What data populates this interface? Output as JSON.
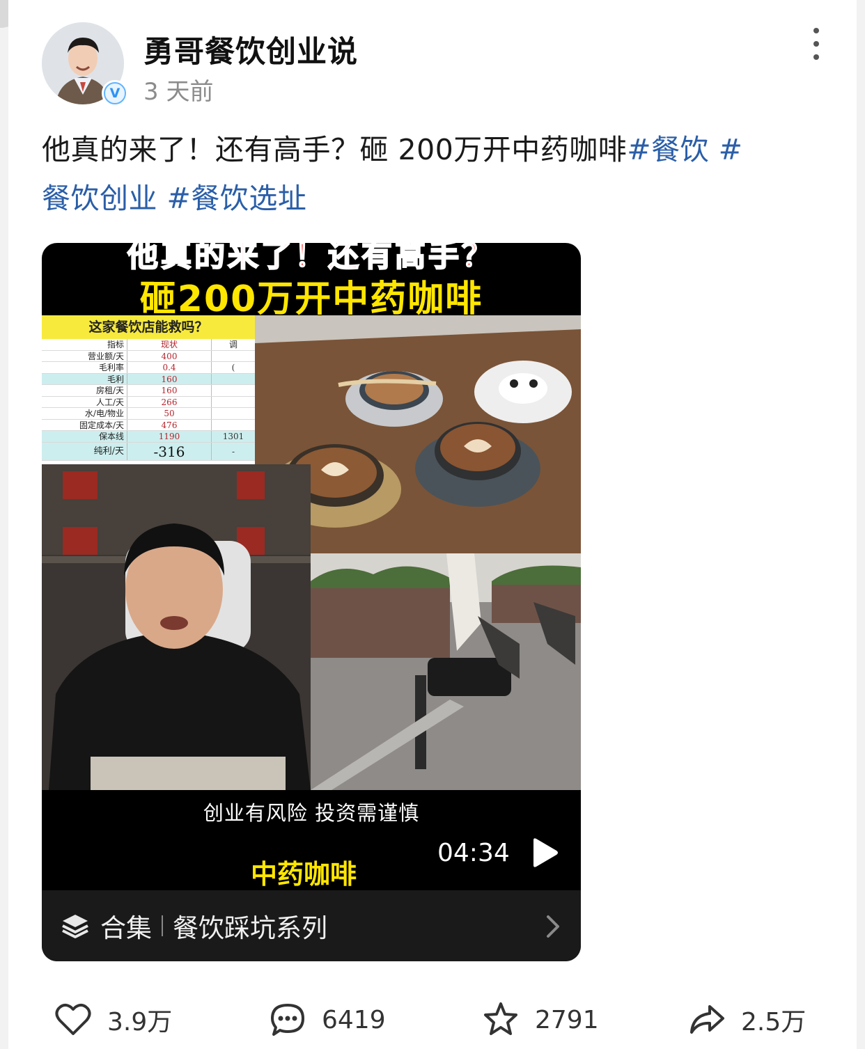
{
  "author": {
    "name": "勇哥餐饮创业说",
    "time": "3 天前",
    "verified_badge": "V"
  },
  "post": {
    "text": "他真的来了！还有高手？砸 200万开中药咖啡",
    "hashtags": [
      "#餐饮 #",
      "餐饮创业 ",
      "#餐饮选址"
    ]
  },
  "video": {
    "title_line1": "他真的来了！还有高手？",
    "title_line2": "砸200万开中药咖啡",
    "table": {
      "heading": "这家餐饮店能救吗？",
      "columns": [
        "指标",
        "现状",
        "调"
      ],
      "rows": [
        {
          "label": "营业额/天",
          "value": "400",
          "extra": ""
        },
        {
          "label": "毛利率",
          "value": "0.4",
          "extra": "("
        },
        {
          "label": "毛利",
          "value": "160",
          "extra": ""
        },
        {
          "label": "房租/天",
          "value": "160",
          "extra": ""
        },
        {
          "label": "人工/天",
          "value": "266",
          "extra": ""
        },
        {
          "label": "水/电/物业",
          "value": "50",
          "extra": ""
        },
        {
          "label": "固定成本/天",
          "value": "476",
          "extra": ""
        },
        {
          "label": "保本线",
          "value": "1190",
          "extra": "1301"
        }
      ],
      "total_label": "纯利/天",
      "total_value": "-316",
      "total_extra": "-"
    },
    "disclaimer": "创业有风险 投资需谨慎",
    "topic_caption": "中药咖啡",
    "duration": "04:34",
    "collection_label": "合集",
    "collection_name": "餐饮踩坑系列"
  },
  "actions": {
    "likes": "3.9万",
    "comments": "6419",
    "favorites": "2791",
    "shares": "2.5万"
  },
  "colors": {
    "hashtag": "#2a5ea8",
    "video_title_red": "#ff3b3b",
    "video_title_yellow": "#ffe600",
    "verified_blue": "#2e93f5"
  },
  "icons": [
    "more-vertical-icon",
    "verified-icon",
    "play-icon",
    "stack-layers-icon",
    "chevron-right-icon",
    "heart-icon",
    "comment-icon",
    "star-icon",
    "share-icon"
  ]
}
